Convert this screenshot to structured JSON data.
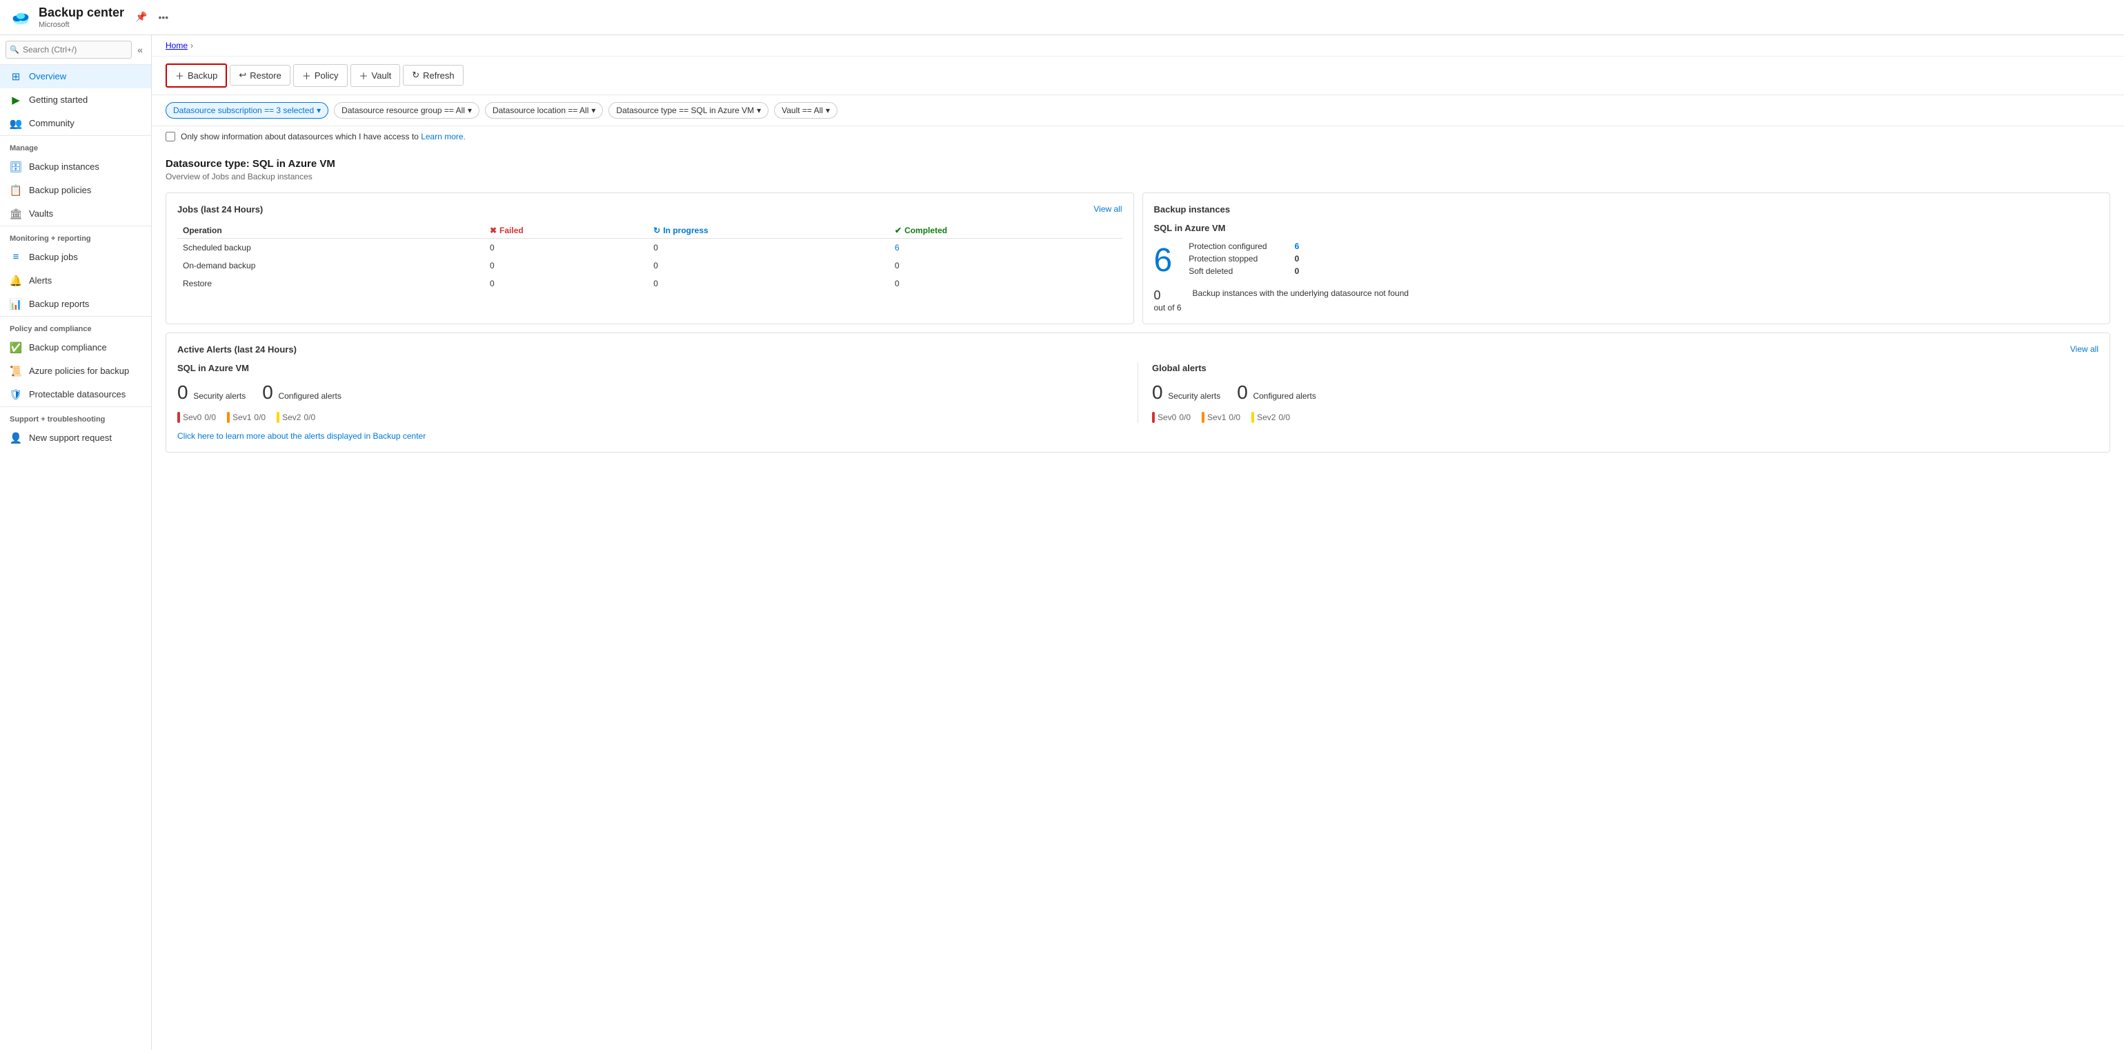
{
  "app": {
    "title": "Backup center",
    "subtitle": "Microsoft",
    "breadcrumb_home": "Home"
  },
  "sidebar": {
    "search_placeholder": "Search (Ctrl+/)",
    "nav_items": [
      {
        "id": "overview",
        "label": "Overview",
        "icon": "⊞",
        "active": true,
        "section": null
      },
      {
        "id": "getting-started",
        "label": "Getting started",
        "icon": "▶",
        "active": false,
        "section": null
      },
      {
        "id": "community",
        "label": "Community",
        "icon": "👥",
        "active": false,
        "section": null
      }
    ],
    "sections": [
      {
        "label": "Manage",
        "items": [
          {
            "id": "backup-instances",
            "label": "Backup instances",
            "icon": "🗄"
          },
          {
            "id": "backup-policies",
            "label": "Backup policies",
            "icon": "📋"
          },
          {
            "id": "vaults",
            "label": "Vaults",
            "icon": "🏛"
          }
        ]
      },
      {
        "label": "Monitoring + reporting",
        "items": [
          {
            "id": "backup-jobs",
            "label": "Backup jobs",
            "icon": "≡"
          },
          {
            "id": "alerts",
            "label": "Alerts",
            "icon": "🔔"
          },
          {
            "id": "backup-reports",
            "label": "Backup reports",
            "icon": "📊"
          }
        ]
      },
      {
        "label": "Policy and compliance",
        "items": [
          {
            "id": "backup-compliance",
            "label": "Backup compliance",
            "icon": "✅"
          },
          {
            "id": "azure-policies",
            "label": "Azure policies for backup",
            "icon": "📜"
          },
          {
            "id": "protectable",
            "label": "Protectable datasources",
            "icon": "🛡"
          }
        ]
      },
      {
        "label": "Support + troubleshooting",
        "items": [
          {
            "id": "new-support",
            "label": "New support request",
            "icon": "👤"
          }
        ]
      }
    ]
  },
  "toolbar": {
    "backup_label": "+ Backup",
    "restore_label": "↩ Restore",
    "policy_label": "+ Policy",
    "vault_label": "+ Vault",
    "refresh_label": "↻ Refresh"
  },
  "filters": [
    {
      "id": "subscription",
      "label": "Datasource subscription == 3 selected",
      "active": true
    },
    {
      "id": "resource-group",
      "label": "Datasource resource group == All",
      "active": false
    },
    {
      "id": "location",
      "label": "Datasource location == All",
      "active": false
    },
    {
      "id": "datasource-type",
      "label": "Datasource type == SQL in Azure VM",
      "active": false
    },
    {
      "id": "vault",
      "label": "Vault == All",
      "active": false
    }
  ],
  "info_bar": {
    "checkbox_label": "Only show information about datasources which I have access to",
    "learn_more_text": "Learn more.",
    "learn_more_href": "#"
  },
  "page": {
    "heading": "Datasource type: SQL in Azure VM",
    "subheading": "Overview of Jobs and Backup instances"
  },
  "jobs_card": {
    "title": "Jobs (last 24 Hours)",
    "view_all_label": "View all",
    "headers": {
      "operation": "Operation",
      "failed": "Failed",
      "in_progress": "In progress",
      "completed": "Completed"
    },
    "rows": [
      {
        "operation": "Scheduled backup",
        "failed": "0",
        "in_progress": "0",
        "completed": "6"
      },
      {
        "operation": "On-demand backup",
        "failed": "0",
        "in_progress": "0",
        "completed": "0"
      },
      {
        "operation": "Restore",
        "failed": "0",
        "in_progress": "0",
        "completed": "0"
      }
    ]
  },
  "backup_instances_card": {
    "title": "Backup instances",
    "section_title": "SQL in Azure VM",
    "big_number": "6",
    "stats": [
      {
        "label": "Protection configured",
        "value": "6",
        "is_link": true
      },
      {
        "label": "Protection stopped",
        "value": "0",
        "is_link": false
      },
      {
        "label": "Soft deleted",
        "value": "0",
        "is_link": false
      }
    ],
    "bottom_number": "0",
    "bottom_out_of": "out of 6",
    "bottom_desc": "Backup instances with the underlying datasource not found"
  },
  "alerts_card": {
    "title": "Active Alerts (last 24 Hours)",
    "view_all_label": "View all",
    "sql_section": {
      "title": "SQL in Azure VM",
      "security_alerts": "0",
      "security_label": "Security alerts",
      "configured_alerts": "0",
      "configured_label": "Configured alerts",
      "sevs": [
        {
          "level": "Sev0",
          "value": "0/0"
        },
        {
          "level": "Sev1",
          "value": "0/0"
        },
        {
          "level": "Sev2",
          "value": "0/0"
        }
      ]
    },
    "global_section": {
      "title": "Global alerts",
      "security_alerts": "0",
      "security_label": "Security alerts",
      "configured_alerts": "0",
      "configured_label": "Configured alerts",
      "sevs": [
        {
          "level": "Sev0",
          "value": "0/0"
        },
        {
          "level": "Sev1",
          "value": "0/0"
        },
        {
          "level": "Sev2",
          "value": "0/0"
        }
      ]
    },
    "footer_link": "Click here to learn more about the alerts displayed in Backup center"
  }
}
